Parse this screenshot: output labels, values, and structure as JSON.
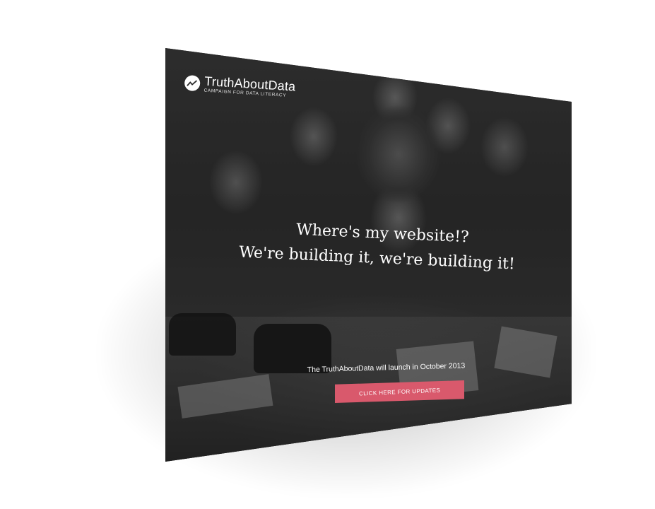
{
  "brand": {
    "name": "TruthAboutData",
    "tagline": "Campaign for Data Literacy"
  },
  "hero": {
    "headline_line1": "Where's my website!?",
    "headline_line2": "We're building it, we're building it!",
    "subline": "The TruthAboutData will launch in October 2013",
    "cta_label": "CLICK HERE FOR UPDATES"
  },
  "colors": {
    "accent": "#d9596c",
    "overlay": "#2c2c2c"
  },
  "icons": {
    "logo": "chart-line-icon"
  }
}
